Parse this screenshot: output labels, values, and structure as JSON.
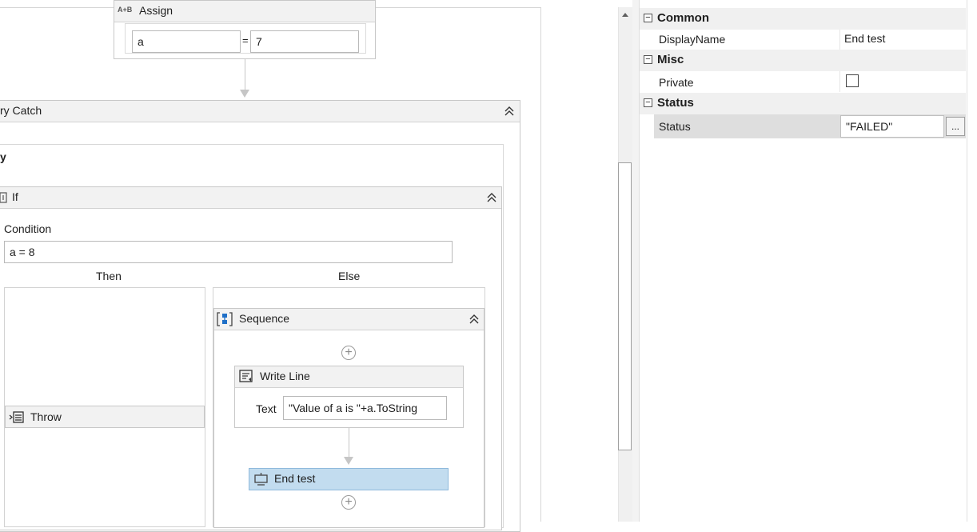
{
  "designer": {
    "assign": {
      "title": "Assign",
      "badge": "A+B",
      "to_value": "a",
      "equals": "=",
      "value_value": "7"
    },
    "try_catch": {
      "title": "ry Catch",
      "try_label": "y"
    },
    "if_activity": {
      "title": "If",
      "condition_label": "Condition",
      "condition_value": "a = 8",
      "then_label": "Then",
      "else_label": "Else"
    },
    "throw": {
      "title": "Throw"
    },
    "sequence": {
      "title": "Sequence"
    },
    "write_line": {
      "title": "Write Line",
      "text_label": "Text",
      "text_value": "\"Value of a is \"+a.ToString"
    },
    "end_test": {
      "title": "End test"
    }
  },
  "properties": {
    "categories": [
      {
        "label": "Common",
        "toggle": "−"
      },
      {
        "label": "Misc",
        "toggle": "−"
      },
      {
        "label": "Status",
        "toggle": "−"
      }
    ],
    "display_name": {
      "name": "DisplayName",
      "value": "End test"
    },
    "private": {
      "name": "Private",
      "checked": false
    },
    "status": {
      "name": "Status",
      "value": "\"FAILED\"",
      "ellipsis": "..."
    }
  },
  "colors": {
    "selected_activity": "#c2dcef",
    "header_gray": "#f2f2f2",
    "accent_blue": "#1e6fc7"
  }
}
